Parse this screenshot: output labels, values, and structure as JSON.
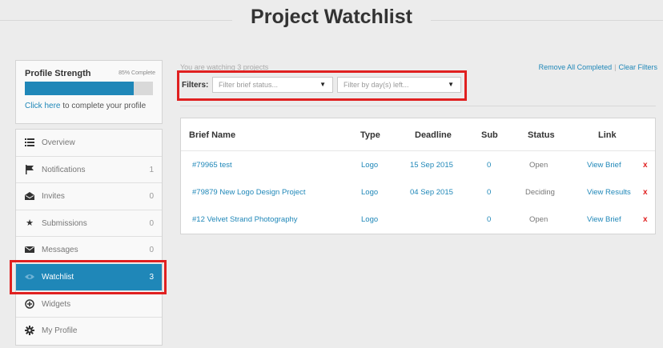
{
  "header": {
    "title": "Project Watchlist"
  },
  "profile": {
    "title": "Profile Strength",
    "completion_text": "85% Complete",
    "completion_fraction": 0.85,
    "link_text": "Click here",
    "link_suffix": " to complete your profile"
  },
  "sidebar": {
    "items": [
      {
        "label": "Overview",
        "count": "",
        "icon": "list-icon"
      },
      {
        "label": "Notifications",
        "count": "1",
        "icon": "flag-icon"
      },
      {
        "label": "Invites",
        "count": "0",
        "icon": "envelope-open-icon"
      },
      {
        "label": "Submissions",
        "count": "0",
        "icon": "star-icon"
      },
      {
        "label": "Messages",
        "count": "0",
        "icon": "envelope-icon"
      },
      {
        "label": "Watchlist",
        "count": "3",
        "icon": "eye-icon"
      },
      {
        "label": "Widgets",
        "count": "",
        "icon": "plus-circle-icon"
      },
      {
        "label": "My Profile",
        "count": "",
        "icon": "gear-icon"
      }
    ]
  },
  "main": {
    "watching_text": "You are watching 3 projects",
    "remove_completed": "Remove All Completed",
    "separator": "|",
    "clear_filters": "Clear Filters",
    "filters_label": "Filters:",
    "filter_status_placeholder": "Filter brief status...",
    "filter_days_placeholder": "Filter by day(s) left..."
  },
  "table": {
    "headers": [
      "Brief Name",
      "Type",
      "Deadline",
      "Sub",
      "Status",
      "Link"
    ],
    "rows": [
      {
        "name": "#79965 test",
        "type": "Logo",
        "deadline": "15 Sep 2015",
        "sub": "0",
        "status": "Open",
        "link": "View Brief",
        "remove": "x"
      },
      {
        "name": "#79879 New Logo Design Project",
        "type": "Logo",
        "deadline": "04 Sep 2015",
        "sub": "0",
        "status": "Deciding",
        "link": "View Results",
        "remove": "x"
      },
      {
        "name": "#12 Velvet Strand Photography",
        "type": "Logo",
        "deadline": "",
        "sub": "0",
        "status": "Open",
        "link": "View Brief",
        "remove": "x"
      }
    ]
  },
  "colors": {
    "accent": "#1f87b8",
    "highlight": "#e02020",
    "remove": "#e02020"
  }
}
